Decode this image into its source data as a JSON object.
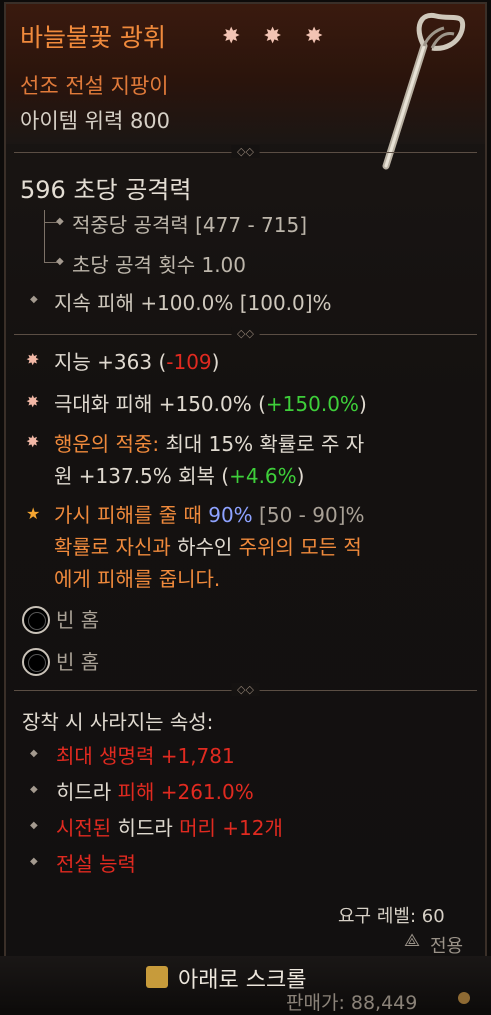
{
  "item": {
    "name": "바늘불꽃 광휘",
    "stars": "✸ ✸ ✸",
    "type": "선조 전설 지팡이",
    "power": "아이템 위력 800"
  },
  "weapon_stats": {
    "dps": "596 초당 공격력",
    "damage_per_hit": "적중당 공격력 [477 - 715]",
    "attack_speed": "초당 공격 횟수 1.00",
    "dot_damage": "지속 피해 +100.0% [100.0]%"
  },
  "affixes": [
    {
      "label": "지능 +363 (",
      "delta": "-109",
      "close": ")"
    },
    {
      "label": "극대화 피해 +150.0% (",
      "delta": "+150.0%",
      "close": ")"
    },
    {
      "label_prefix": "행운의 적중:",
      "label_rest": " 최대 15% 확률로 주 자",
      "line2": "원 +137.5% 회복 (",
      "delta": "+4.6%",
      "close": ")"
    }
  ],
  "legendary": {
    "line1_a": "가시 피해를 줄 때 ",
    "line1_b": "90%",
    "line1_c": " [50 - 90]%",
    "line2_a": "확률로 자신과 ",
    "line2_b": "하수인",
    "line2_c": " 주위의 모든 적",
    "line3": "에게 피해를 줍니다."
  },
  "sockets": [
    {
      "label": "빈 홈"
    },
    {
      "label": "빈 홈"
    }
  ],
  "lost_on_equip": {
    "title": "장착 시 사라지는 속성:",
    "items": [
      {
        "a": "최대 생명력 +1,781"
      },
      {
        "a": "히드라 ",
        "b": "피해 +261.0%"
      },
      {
        "a": "시전된",
        "b": " 히드라 ",
        "c": "머리 +12개"
      },
      {
        "a": "전설 능력"
      }
    ]
  },
  "requirements": {
    "level": "요구 레벨: 60",
    "class": "전용"
  },
  "footer": {
    "scroll": "아래로 스크롤",
    "sell": "판매가: 88,449"
  },
  "colors": {
    "title": "#f08a3c",
    "negative": "#e02a20",
    "positive": "#3ecf3a",
    "highlight_blue": "#8ea2ff"
  }
}
